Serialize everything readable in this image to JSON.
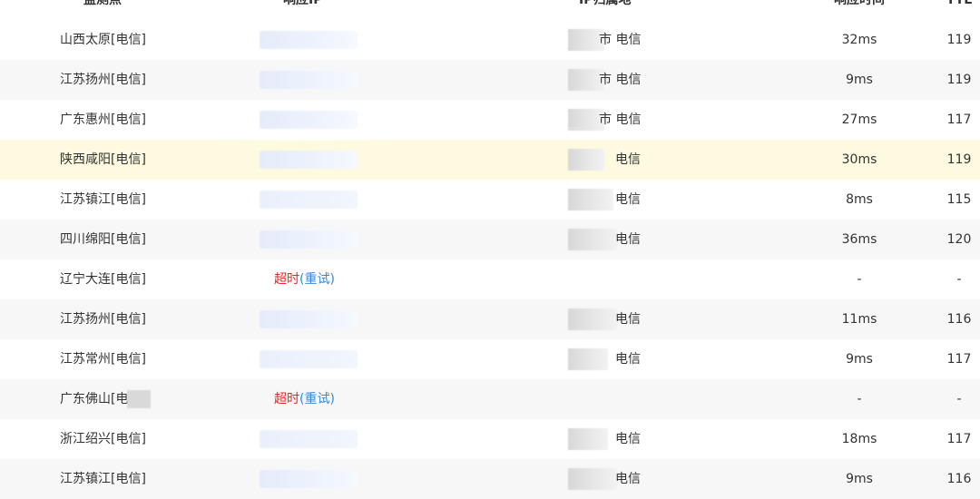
{
  "header": {
    "node": "监测点",
    "ip": "响应IP",
    "geo": "IP归属地",
    "time": "响应时间",
    "ttl": "TTL"
  },
  "rows": [
    {
      "node": "山西太原[电信]",
      "geo": "市 电信",
      "time": "32ms",
      "ttl": "119"
    },
    {
      "node": "江苏扬州[电信]",
      "geo": "市 电信",
      "time": "9ms",
      "ttl": "119"
    },
    {
      "node": "广东惠州[电信]",
      "geo": "市 电信",
      "time": "27ms",
      "ttl": "117"
    },
    {
      "node": "陕西咸阳[电信]",
      "geo": "电信",
      "time": "30ms",
      "ttl": "119"
    },
    {
      "node": "江苏镇江[电信]",
      "geo": "电信",
      "time": "8ms",
      "ttl": "115"
    },
    {
      "node": "四川绵阳[电信]",
      "geo": "电信",
      "time": "36ms",
      "ttl": "120"
    },
    {
      "node": "辽宁大连[电信]",
      "timeout": "超时",
      "retry": "(重试)",
      "time": "-",
      "ttl": "-"
    },
    {
      "node": "江苏扬州[电信]",
      "geo": "电信",
      "time": "11ms",
      "ttl": "116"
    },
    {
      "node": "江苏常州[电信]",
      "geo": "电信",
      "time": "9ms",
      "ttl": "117"
    },
    {
      "node": "广东佛山[电",
      "timeout": "超时",
      "retry": "(重试)",
      "time": "-",
      "ttl": "-"
    },
    {
      "node": "浙江绍兴[电信]",
      "geo": "电信",
      "time": "18ms",
      "ttl": "117"
    },
    {
      "node": "江苏镇江[电信]",
      "geo": "电信",
      "time": "9ms",
      "ttl": "116"
    }
  ]
}
